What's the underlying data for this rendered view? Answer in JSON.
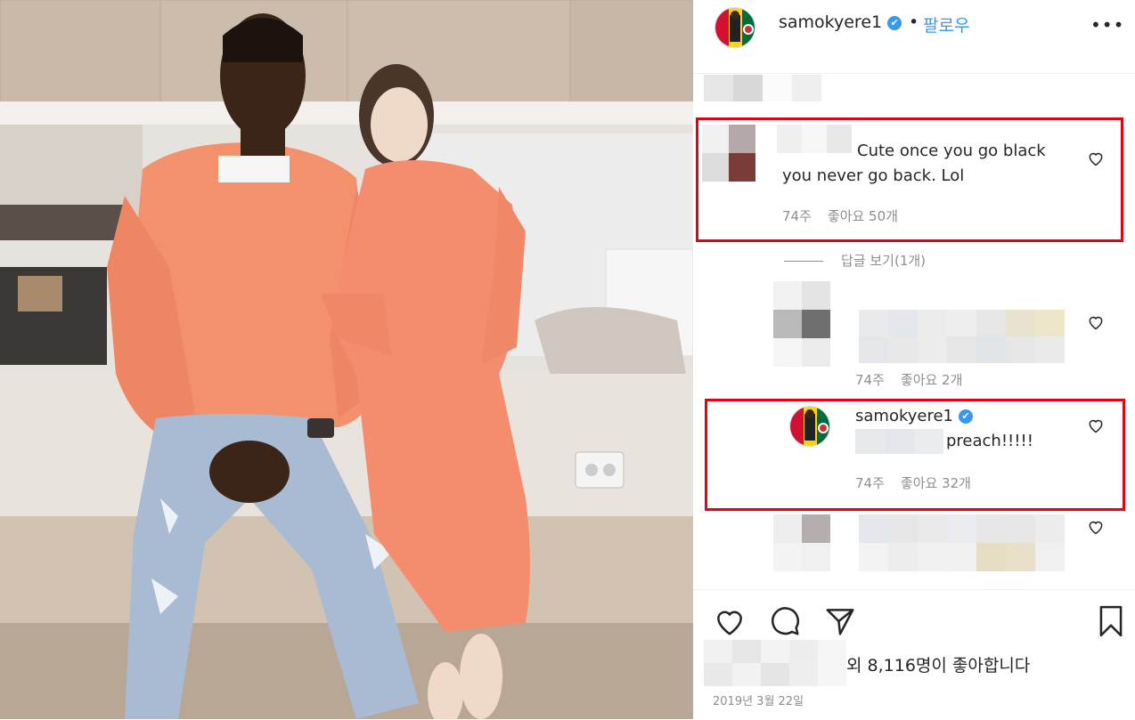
{
  "post": {
    "username": "samokyere1",
    "verified_label": "✔",
    "separator": "•",
    "follow_label": "팔로우",
    "more_label": "•••"
  },
  "comments": [
    {
      "text_line1": "Cute once you go black",
      "text_line2": "you never go back. Lol",
      "time": "74주",
      "likes": "좋아요 50개",
      "highlighted": true
    },
    {
      "time": "74주",
      "likes": "좋아요 2개",
      "highlighted": false
    },
    {
      "username": "samokyere1",
      "text": "preach!!!!!",
      "time": "74주",
      "likes": "좋아요 32개",
      "highlighted": true
    }
  ],
  "view_replies_label": "답글 보기(1개)",
  "footer": {
    "likes_text": "외 8,116명이 좋아합니다",
    "date": "2019년 3월 22일"
  },
  "colors": {
    "highlight_border": "#e60012",
    "link_blue": "#3897f0",
    "muted_text": "#8e8e8e"
  },
  "icons": [
    "heart-icon",
    "comment-icon",
    "share-icon",
    "bookmark-icon",
    "verified-icon",
    "more-icon"
  ]
}
